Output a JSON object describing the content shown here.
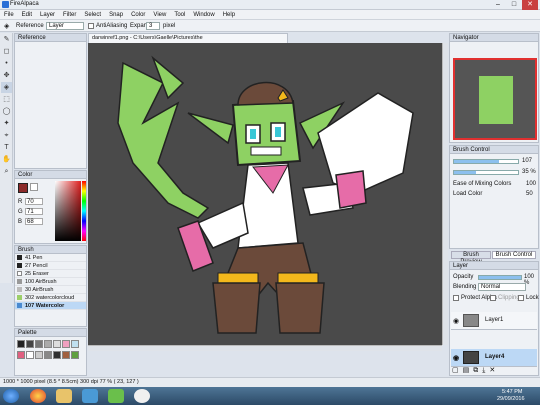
{
  "window": {
    "title": "FireAlpaca",
    "min": "–",
    "max": "□",
    "close": "✕"
  },
  "menu": [
    "File",
    "Edit",
    "Layer",
    "Filter",
    "Select",
    "Snap",
    "Color",
    "View",
    "Tool",
    "Window",
    "Help"
  ],
  "toolbar": {
    "reference_label": "Reference",
    "reference_value": "Layer",
    "antialiasing_label": "AntiAliasing",
    "expand_label": "Expand",
    "expand_value": "3",
    "expand_unit": "pixel"
  },
  "document_tab": "darwinref1.png - C:\\Users\\Gaelle\\Pictures\\the arts\\artirist\\characters\\darwinref1.png",
  "reference_panel": {
    "title": "Reference"
  },
  "color_panel": {
    "title": "Color",
    "r_label": "R",
    "r": "70",
    "g_label": "G",
    "g": "71",
    "b_label": "B",
    "b": "68",
    "primary": "#46473f"
  },
  "brush_panel": {
    "title": "Brush",
    "items": [
      {
        "size": "41",
        "name": "Pen"
      },
      {
        "size": "27",
        "name": "Pencil"
      },
      {
        "size": "25",
        "name": "Eraser"
      },
      {
        "size": "100",
        "name": "AirBrush"
      },
      {
        "size": "30",
        "name": "AirBrush"
      },
      {
        "size": "302",
        "name": "watercolorcloud"
      },
      {
        "size": "107",
        "name": "Watercolor",
        "selected": true
      }
    ]
  },
  "palette_panel": {
    "title": "Palette",
    "colors": [
      "#222222",
      "#444444",
      "#777777",
      "#aaaaaa",
      "#dddddd",
      "#f0a0c0",
      "#c0e0f0",
      "#e06080",
      "#ffffff",
      "#cccccc",
      "#888888",
      "#303030",
      "#a06040",
      "#60a040"
    ]
  },
  "navigator_panel": {
    "title": "Navigator"
  },
  "brush_control": {
    "title": "Brush Control",
    "size": "107",
    "opacity": "35 %",
    "ease_label": "Ease of Mixing Colors",
    "ease_value": "100",
    "load_label": "Load Color",
    "load_value": "50",
    "size_frac": 0.7,
    "opacity_frac": 0.35
  },
  "tabs": [
    "Brush Preview",
    "Brush Control"
  ],
  "layer_panel": {
    "title": "Layer",
    "opacity_label": "Opacity",
    "opacity": "100 %",
    "blending_label": "Blending",
    "blending": "Normal",
    "protect_alpha": "Protect Alpha",
    "clipping": "Clipping",
    "lock": "Lock",
    "layers": [
      {
        "name": "Layer1",
        "selected": false
      },
      {
        "name": "Layer4",
        "selected": true
      }
    ]
  },
  "status": "1000 * 1000 pixel  (8.5 * 8.5cm)  300 dpi   77 %   ( 23, 127 )",
  "taskbar": {
    "time": "5:47 PM",
    "date": "29/09/2016"
  }
}
